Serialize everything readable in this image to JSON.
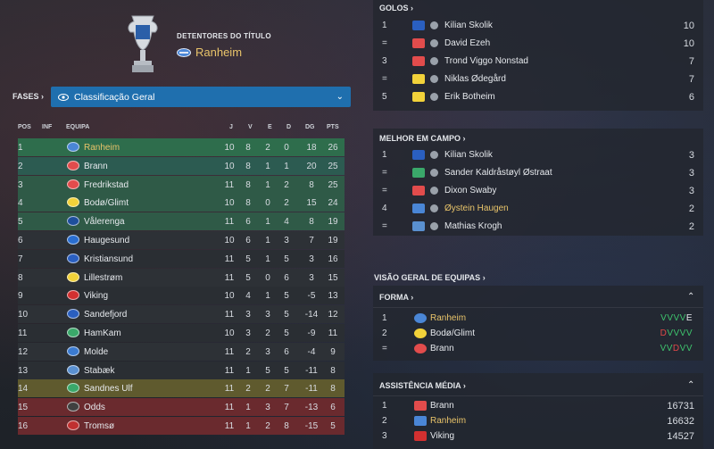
{
  "holders": {
    "label": "DETENTORES DO TÍTULO",
    "team": "Ranheim"
  },
  "stages": {
    "label": "FASES",
    "selected": "Classificação Geral"
  },
  "table": {
    "headers": [
      "POS",
      "INF",
      "EQUIPA",
      "J",
      "V",
      "E",
      "D",
      "DG",
      "PTS"
    ],
    "rows": [
      {
        "pos": "1",
        "team": "Ranheim",
        "j": "10",
        "v": "8",
        "e": "2",
        "d": "0",
        "dg": "18",
        "pts": "26"
      },
      {
        "pos": "2",
        "team": "Brann",
        "j": "10",
        "v": "8",
        "e": "1",
        "d": "1",
        "dg": "20",
        "pts": "25"
      },
      {
        "pos": "3",
        "team": "Fredrikstad",
        "j": "11",
        "v": "8",
        "e": "1",
        "d": "2",
        "dg": "8",
        "pts": "25"
      },
      {
        "pos": "4",
        "team": "Bodø/Glimt",
        "j": "10",
        "v": "8",
        "e": "0",
        "d": "2",
        "dg": "15",
        "pts": "24"
      },
      {
        "pos": "5",
        "team": "Vålerenga",
        "j": "11",
        "v": "6",
        "e": "1",
        "d": "4",
        "dg": "8",
        "pts": "19"
      },
      {
        "pos": "6",
        "team": "Haugesund",
        "j": "10",
        "v": "6",
        "e": "1",
        "d": "3",
        "dg": "7",
        "pts": "19"
      },
      {
        "pos": "7",
        "team": "Kristiansund",
        "j": "11",
        "v": "5",
        "e": "1",
        "d": "5",
        "dg": "3",
        "pts": "16"
      },
      {
        "pos": "8",
        "team": "Lillestrøm",
        "j": "11",
        "v": "5",
        "e": "0",
        "d": "6",
        "dg": "3",
        "pts": "15"
      },
      {
        "pos": "9",
        "team": "Viking",
        "j": "10",
        "v": "4",
        "e": "1",
        "d": "5",
        "dg": "-5",
        "pts": "13"
      },
      {
        "pos": "10",
        "team": "Sandefjord",
        "j": "11",
        "v": "3",
        "e": "3",
        "d": "5",
        "dg": "-14",
        "pts": "12"
      },
      {
        "pos": "11",
        "team": "HamKam",
        "j": "10",
        "v": "3",
        "e": "2",
        "d": "5",
        "dg": "-9",
        "pts": "11"
      },
      {
        "pos": "12",
        "team": "Molde",
        "j": "11",
        "v": "2",
        "e": "3",
        "d": "6",
        "dg": "-4",
        "pts": "9"
      },
      {
        "pos": "13",
        "team": "Stabæk",
        "j": "11",
        "v": "1",
        "e": "5",
        "d": "5",
        "dg": "-11",
        "pts": "8"
      },
      {
        "pos": "14",
        "team": "Sandnes Ulf",
        "j": "11",
        "v": "2",
        "e": "2",
        "d": "7",
        "dg": "-11",
        "pts": "8"
      },
      {
        "pos": "15",
        "team": "Odds",
        "j": "11",
        "v": "1",
        "e": "3",
        "d": "7",
        "dg": "-13",
        "pts": "6"
      },
      {
        "pos": "16",
        "team": "Tromsø",
        "j": "11",
        "v": "1",
        "e": "2",
        "d": "8",
        "dg": "-15",
        "pts": "5"
      }
    ]
  },
  "goals": {
    "title": "GOLOS",
    "rows": [
      {
        "pos": "1",
        "name": "Kilian Skolik",
        "value": "10"
      },
      {
        "pos": "=",
        "name": "David Ezeh",
        "value": "10"
      },
      {
        "pos": "3",
        "name": "Trond Viggo Nonstad",
        "value": "7"
      },
      {
        "pos": "=",
        "name": "Niklas Ødegård",
        "value": "7"
      },
      {
        "pos": "5",
        "name": "Erik Botheim",
        "value": "6"
      }
    ]
  },
  "motm": {
    "title": "MELHOR EM CAMPO",
    "rows": [
      {
        "pos": "1",
        "name": "Kilian Skolik",
        "value": "3"
      },
      {
        "pos": "=",
        "name": "Sander Kaldråstøyl Østraat",
        "value": "3"
      },
      {
        "pos": "=",
        "name": "Dixon Swaby",
        "value": "3"
      },
      {
        "pos": "4",
        "name": "Øystein Haugen",
        "value": "2"
      },
      {
        "pos": "=",
        "name": "Mathias Krogh",
        "value": "2"
      }
    ]
  },
  "overview": {
    "title": "VISÃO GERAL DE EQUIPAS",
    "form": {
      "title": "FORMA",
      "rows": [
        {
          "pos": "1",
          "team": "Ranheim",
          "form": [
            "V",
            "V",
            "V",
            "V",
            "E"
          ]
        },
        {
          "pos": "2",
          "team": "Bodø/Glimt",
          "form": [
            "D",
            "V",
            "V",
            "V",
            "V"
          ]
        },
        {
          "pos": "=",
          "team": "Brann",
          "form": [
            "V",
            "V",
            "D",
            "V",
            "V"
          ]
        }
      ]
    },
    "attendance": {
      "title": "ASSISTÊNCIA MÉDIA",
      "rows": [
        {
          "pos": "1",
          "team": "Brann",
          "value": "16731"
        },
        {
          "pos": "2",
          "team": "Ranheim",
          "value": "16632"
        },
        {
          "pos": "3",
          "team": "Viking",
          "value": "14527"
        }
      ]
    }
  }
}
